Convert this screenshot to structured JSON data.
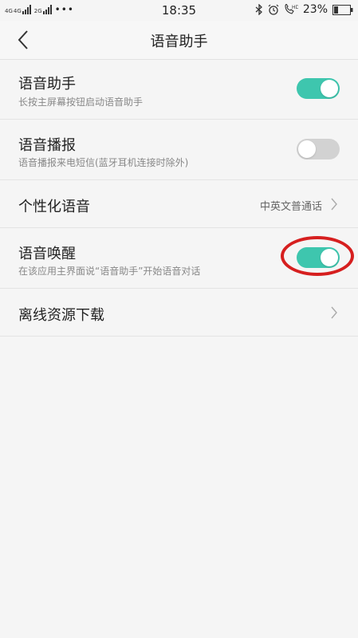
{
  "status_bar": {
    "network_left": "4G",
    "network_right": "4G",
    "sim2_label": "2G",
    "dots": "•••",
    "time": "18:35",
    "battery": "23%"
  },
  "header": {
    "title": "语音助手"
  },
  "rows": [
    {
      "title": "语音助手",
      "subtitle": "长按主屏幕按钮启动语音助手",
      "toggle": "on"
    },
    {
      "title": "语音播报",
      "subtitle": "语音播报来电短信(蓝牙耳机连接时除外)",
      "toggle": "off"
    },
    {
      "title": "个性化语音",
      "value": "中英文普通话"
    },
    {
      "title": "语音唤醒",
      "subtitle": "在该应用主界面说“语音助手”开始语音对话",
      "toggle": "on"
    },
    {
      "title": "离线资源下载"
    }
  ],
  "colors": {
    "accent": "#3ec6ae",
    "toggle_off": "#d2d2d2",
    "annotation": "#d61f1f"
  }
}
